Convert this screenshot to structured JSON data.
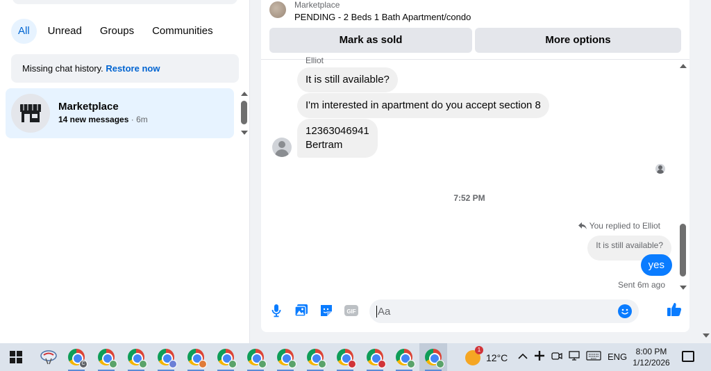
{
  "sidebar": {
    "filters": [
      "All",
      "Unread",
      "Groups",
      "Communities"
    ],
    "notice_text": "Missing chat history.",
    "notice_link": "Restore now",
    "conversation": {
      "title": "Marketplace",
      "unread": "14 new messages",
      "time": "· 6m"
    }
  },
  "header": {
    "name": "Marketplace",
    "listing": "PENDING - 2 Beds 1 Bath Apartment/condo",
    "mark_sold": "Mark as sold",
    "more_options": "More options"
  },
  "messages": {
    "sender": "Elliot",
    "incoming": [
      "It is still available?",
      "I'm interested in apartment do you accept section 8",
      "12363046941\nBertram"
    ],
    "timestamp": "7:52 PM",
    "replied_label": "You replied to Elliot",
    "quoted": "It is still available?",
    "outgoing": "yes",
    "sent_status": "Sent 6m ago"
  },
  "composer": {
    "placeholder": "Aa",
    "icons": [
      "microphone-icon",
      "photo-icon",
      "sticker-icon",
      "gif-icon",
      "emoji-icon",
      "thumbs-up-icon"
    ],
    "gif_label": "GIF"
  },
  "taskbar": {
    "app_count": 13,
    "weather_badge": "1",
    "temperature": "12°C",
    "language": "ENG",
    "time": "8:00 PM",
    "date": "1/12/2026",
    "chrome_badge": "C"
  },
  "colors": {
    "accent": "#0064d1",
    "bubble_mine": "#0a7cff",
    "bubble_theirs": "#f0f0f0"
  }
}
